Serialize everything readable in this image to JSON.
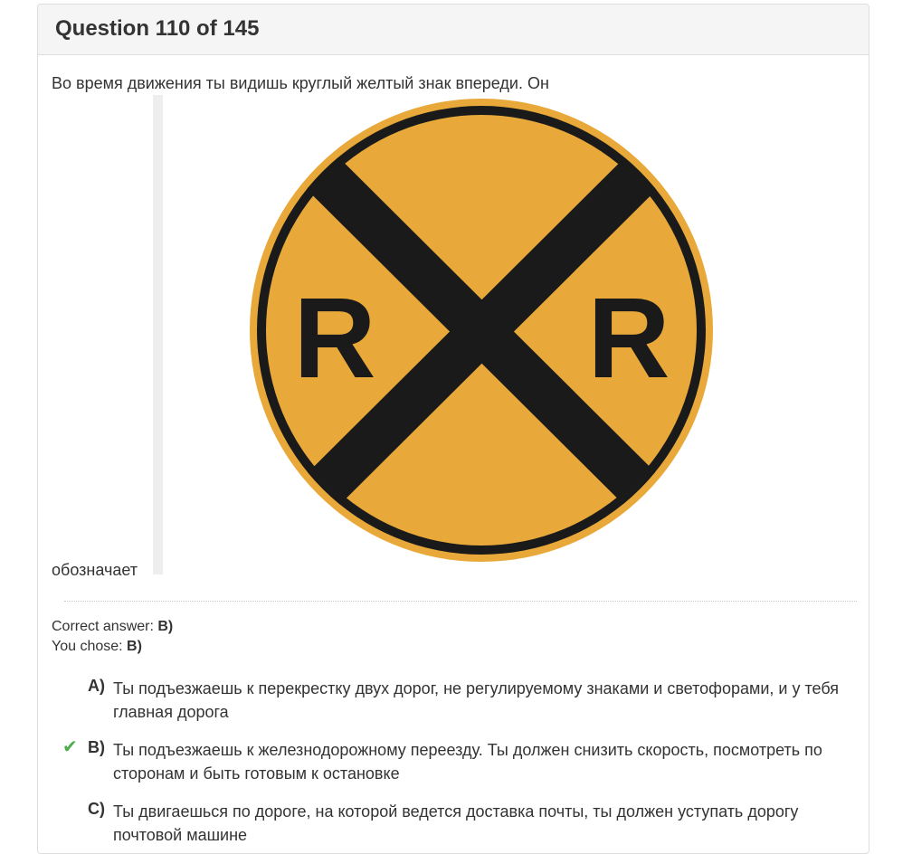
{
  "header": {
    "title": "Question 110 of 145"
  },
  "question": {
    "text_before_image": "Во время движения ты видишь круглый желтый знак впереди. Он",
    "text_after_image": "обозначает",
    "image": {
      "description_icon": "railroad-crossing-sign",
      "letters": [
        "R",
        "R"
      ],
      "colors": {
        "fill": "#e8a93a",
        "ink": "#1a1a1a"
      }
    }
  },
  "result": {
    "correct_label": "Correct answer:",
    "correct_value": "B)",
    "chosen_label": "You chose:",
    "chosen_value": "B)"
  },
  "options": [
    {
      "letter": "A)",
      "text": "Ты подъезжаешь к перекрестку двух дорог, не регулируемому знаками и светофорами, и у тебя главная дорога",
      "correct": false
    },
    {
      "letter": "B)",
      "text": "Ты подъезжаешь к железнодорожному переезду. Ты должен снизить скорость, посмотреть по сторонам и быть готовым к остановке",
      "correct": true,
      "check_icon": "✔"
    },
    {
      "letter": "C)",
      "text": "Ты двигаешься по дороге, на которой ведется доставка почты, ты должен уступать дорогу почтовой машине",
      "correct": false
    }
  ],
  "colors": {
    "check": "#4cae4c",
    "header_bg": "#f5f5f5",
    "border": "#dddddd"
  }
}
